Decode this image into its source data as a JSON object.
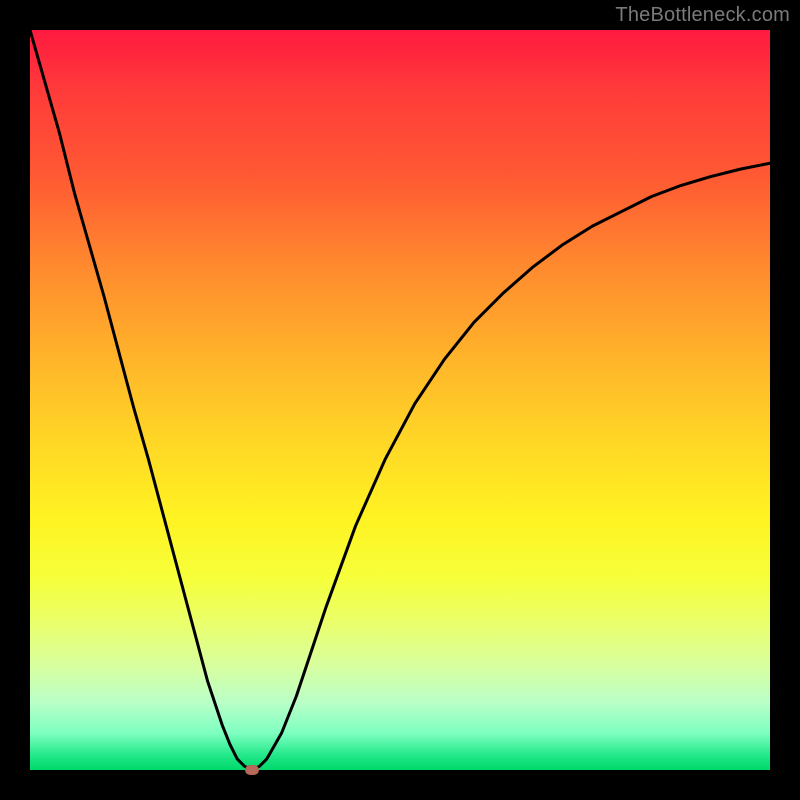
{
  "watermark": "TheBottleneck.com",
  "colors": {
    "frame": "#000000",
    "gradient_top": "#ff1a40",
    "gradient_mid": "#ffe022",
    "gradient_bottom": "#00d86a",
    "curve": "#000000",
    "marker": "#b86a5a"
  },
  "chart_data": {
    "type": "line",
    "title": "",
    "xlabel": "",
    "ylabel": "",
    "xlim": [
      0,
      100
    ],
    "ylim": [
      0,
      100
    ],
    "x": [
      0,
      2,
      4,
      6,
      8,
      10,
      12,
      14,
      16,
      18,
      20,
      22,
      24,
      26,
      27,
      28,
      29,
      30,
      31,
      32,
      34,
      36,
      38,
      40,
      44,
      48,
      52,
      56,
      60,
      64,
      68,
      72,
      76,
      80,
      84,
      88,
      92,
      96,
      100
    ],
    "values": [
      100,
      93,
      86,
      78,
      71,
      64,
      56.5,
      49,
      42,
      34.5,
      27,
      19.5,
      12,
      6,
      3.5,
      1.5,
      0.5,
      0,
      0.5,
      1.5,
      5,
      10,
      16,
      22,
      33,
      42,
      49.5,
      55.5,
      60.5,
      64.5,
      68,
      71,
      73.5,
      75.5,
      77.5,
      79,
      80.2,
      81.2,
      82
    ],
    "marker": {
      "x": 30,
      "y": 0
    }
  }
}
